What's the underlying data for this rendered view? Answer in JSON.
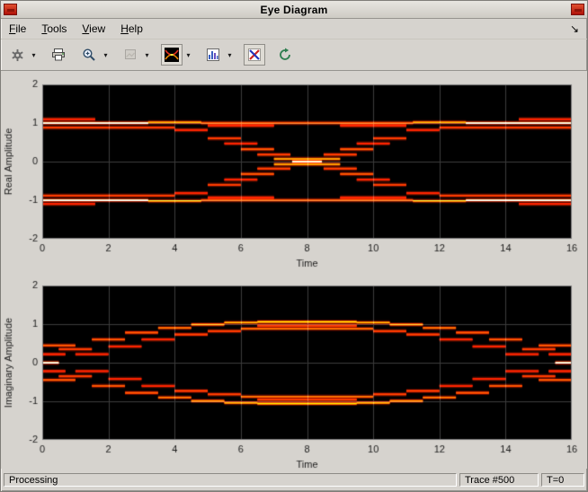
{
  "window": {
    "title": "Eye Diagram"
  },
  "menu": {
    "items": [
      "File",
      "Tools",
      "View",
      "Help"
    ],
    "dock_arrow": "↘"
  },
  "toolbar": {
    "caret": "▾",
    "buttons": [
      "settings",
      "print",
      "zoom-in",
      "snapshot",
      "eye-diagram",
      "histogram",
      "compare",
      "autorefresh"
    ]
  },
  "status": {
    "processing": "Processing",
    "trace": "Trace #500",
    "time": "T=0"
  },
  "chart_data": [
    {
      "type": "line",
      "title": "",
      "xlabel": "Time",
      "ylabel": "Real Amplitude",
      "xlim": [
        0,
        16
      ],
      "ylim": [
        -2,
        2
      ],
      "xticks": [
        0,
        2,
        4,
        6,
        8,
        10,
        12,
        14,
        16
      ],
      "yticks": [
        -2,
        -1,
        0,
        1,
        2
      ],
      "grid": true,
      "bg": "#000000",
      "colormap": "hot",
      "segments": [
        [
          0,
          3.2,
          1.0,
          1.0
        ],
        [
          3.2,
          4.8,
          1.02,
          0.7
        ],
        [
          4.8,
          11.2,
          1.0,
          0.55
        ],
        [
          11.2,
          12.8,
          1.02,
          0.7
        ],
        [
          12.8,
          16,
          1.0,
          1.0
        ],
        [
          0,
          4,
          0.88,
          0.5
        ],
        [
          12,
          16,
          0.88,
          0.5
        ],
        [
          0,
          1.6,
          1.1,
          0.4
        ],
        [
          14.4,
          16,
          1.1,
          0.4
        ],
        [
          0,
          3.2,
          -1.0,
          1.0
        ],
        [
          3.2,
          4.8,
          -1.02,
          0.7
        ],
        [
          4.8,
          11.2,
          -1.0,
          0.55
        ],
        [
          11.2,
          12.8,
          -1.02,
          0.7
        ],
        [
          12.8,
          16,
          -1.0,
          1.0
        ],
        [
          0,
          4,
          -0.88,
          0.5
        ],
        [
          12,
          16,
          -0.88,
          0.5
        ],
        [
          0,
          1.6,
          -1.1,
          0.4
        ],
        [
          14.4,
          16,
          -1.1,
          0.4
        ],
        [
          4,
          5,
          0.82,
          0.45
        ],
        [
          5,
          6,
          0.6,
          0.5
        ],
        [
          5.5,
          6.5,
          0.47,
          0.45
        ],
        [
          6,
          7,
          0.32,
          0.55
        ],
        [
          6.5,
          7.5,
          0.18,
          0.5
        ],
        [
          7,
          8,
          0.07,
          0.7
        ],
        [
          8,
          9,
          -0.07,
          0.7
        ],
        [
          8.5,
          9.5,
          -0.18,
          0.5
        ],
        [
          9,
          10,
          -0.32,
          0.55
        ],
        [
          9.5,
          10.5,
          -0.47,
          0.45
        ],
        [
          10,
          11,
          -0.6,
          0.5
        ],
        [
          11,
          12,
          -0.82,
          0.45
        ],
        [
          4,
          5,
          -0.82,
          0.45
        ],
        [
          5,
          6,
          -0.6,
          0.5
        ],
        [
          5.5,
          6.5,
          -0.47,
          0.45
        ],
        [
          6,
          7,
          -0.32,
          0.55
        ],
        [
          6.5,
          7.5,
          -0.18,
          0.5
        ],
        [
          7,
          8,
          -0.07,
          0.7
        ],
        [
          8,
          9,
          0.07,
          0.7
        ],
        [
          8.5,
          9.5,
          0.18,
          0.5
        ],
        [
          9,
          10,
          0.32,
          0.55
        ],
        [
          9.5,
          10.5,
          0.47,
          0.45
        ],
        [
          10,
          11,
          0.6,
          0.5
        ],
        [
          11,
          12,
          0.82,
          0.45
        ],
        [
          7.55,
          8.45,
          0,
          1.0
        ],
        [
          5,
          7,
          0.93,
          0.45
        ],
        [
          9,
          11,
          0.93,
          0.45
        ],
        [
          5,
          7,
          -0.93,
          0.45
        ],
        [
          9,
          11,
          -0.93,
          0.45
        ]
      ]
    },
    {
      "type": "line",
      "title": "",
      "xlabel": "Time",
      "ylabel": "Imaginary Amplitude",
      "xlim": [
        0,
        16
      ],
      "ylim": [
        -2,
        2
      ],
      "xticks": [
        0,
        2,
        4,
        6,
        8,
        10,
        12,
        14,
        16
      ],
      "yticks": [
        -2,
        -1,
        0,
        1,
        2
      ],
      "grid": true,
      "bg": "#000000",
      "colormap": "hot",
      "segments": [
        [
          0,
          0.5,
          0,
          1.0
        ],
        [
          15.5,
          16,
          0,
          1.0
        ],
        [
          0,
          1,
          0.45,
          0.55
        ],
        [
          0,
          1,
          -0.45,
          0.55
        ],
        [
          15,
          16,
          0.45,
          0.55
        ],
        [
          15,
          16,
          -0.45,
          0.55
        ],
        [
          0,
          0.7,
          0.22,
          0.45
        ],
        [
          0,
          0.7,
          -0.22,
          0.45
        ],
        [
          15.3,
          16,
          0.22,
          0.45
        ],
        [
          15.3,
          16,
          -0.22,
          0.45
        ],
        [
          0.5,
          1.5,
          0.35,
          0.5
        ],
        [
          1.5,
          2.5,
          0.6,
          0.55
        ],
        [
          2.5,
          3.5,
          0.78,
          0.55
        ],
        [
          3.5,
          4.5,
          0.9,
          0.6
        ],
        [
          4.5,
          5.5,
          0.99,
          0.65
        ],
        [
          5.5,
          6.5,
          1.04,
          0.7
        ],
        [
          6.5,
          9.5,
          1.06,
          0.8
        ],
        [
          9.5,
          10.5,
          1.04,
          0.7
        ],
        [
          10.5,
          11.5,
          0.99,
          0.65
        ],
        [
          11.5,
          12.5,
          0.9,
          0.6
        ],
        [
          12.5,
          13.5,
          0.78,
          0.55
        ],
        [
          13.5,
          14.5,
          0.6,
          0.55
        ],
        [
          14.5,
          15.5,
          0.35,
          0.5
        ],
        [
          1,
          2,
          0.22,
          0.4
        ],
        [
          2,
          3,
          0.42,
          0.45
        ],
        [
          3,
          4,
          0.6,
          0.45
        ],
        [
          4,
          5,
          0.73,
          0.5
        ],
        [
          5,
          6,
          0.82,
          0.5
        ],
        [
          6,
          10,
          0.88,
          0.6
        ],
        [
          10,
          11,
          0.82,
          0.5
        ],
        [
          11,
          12,
          0.73,
          0.5
        ],
        [
          12,
          13,
          0.6,
          0.45
        ],
        [
          13,
          14,
          0.42,
          0.45
        ],
        [
          14,
          15,
          0.22,
          0.4
        ],
        [
          0.5,
          1.5,
          -0.35,
          0.5
        ],
        [
          1.5,
          2.5,
          -0.6,
          0.55
        ],
        [
          2.5,
          3.5,
          -0.78,
          0.55
        ],
        [
          3.5,
          4.5,
          -0.9,
          0.6
        ],
        [
          4.5,
          5.5,
          -0.99,
          0.65
        ],
        [
          5.5,
          6.5,
          -1.04,
          0.7
        ],
        [
          6.5,
          9.5,
          -1.06,
          0.8
        ],
        [
          9.5,
          10.5,
          -1.04,
          0.7
        ],
        [
          10.5,
          11.5,
          -0.99,
          0.65
        ],
        [
          11.5,
          12.5,
          -0.9,
          0.6
        ],
        [
          12.5,
          13.5,
          -0.78,
          0.55
        ],
        [
          13.5,
          14.5,
          -0.6,
          0.55
        ],
        [
          14.5,
          15.5,
          -0.35,
          0.5
        ],
        [
          1,
          2,
          -0.22,
          0.4
        ],
        [
          2,
          3,
          -0.42,
          0.45
        ],
        [
          3,
          4,
          -0.6,
          0.45
        ],
        [
          4,
          5,
          -0.73,
          0.5
        ],
        [
          5,
          6,
          -0.82,
          0.5
        ],
        [
          6,
          10,
          -0.88,
          0.6
        ],
        [
          10,
          11,
          -0.82,
          0.5
        ],
        [
          11,
          12,
          -0.73,
          0.5
        ],
        [
          12,
          13,
          -0.6,
          0.45
        ],
        [
          13,
          14,
          -0.42,
          0.45
        ],
        [
          14,
          15,
          -0.22,
          0.4
        ],
        [
          6.5,
          9.5,
          0.96,
          0.5
        ],
        [
          6.5,
          9.5,
          -0.96,
          0.5
        ]
      ]
    }
  ]
}
